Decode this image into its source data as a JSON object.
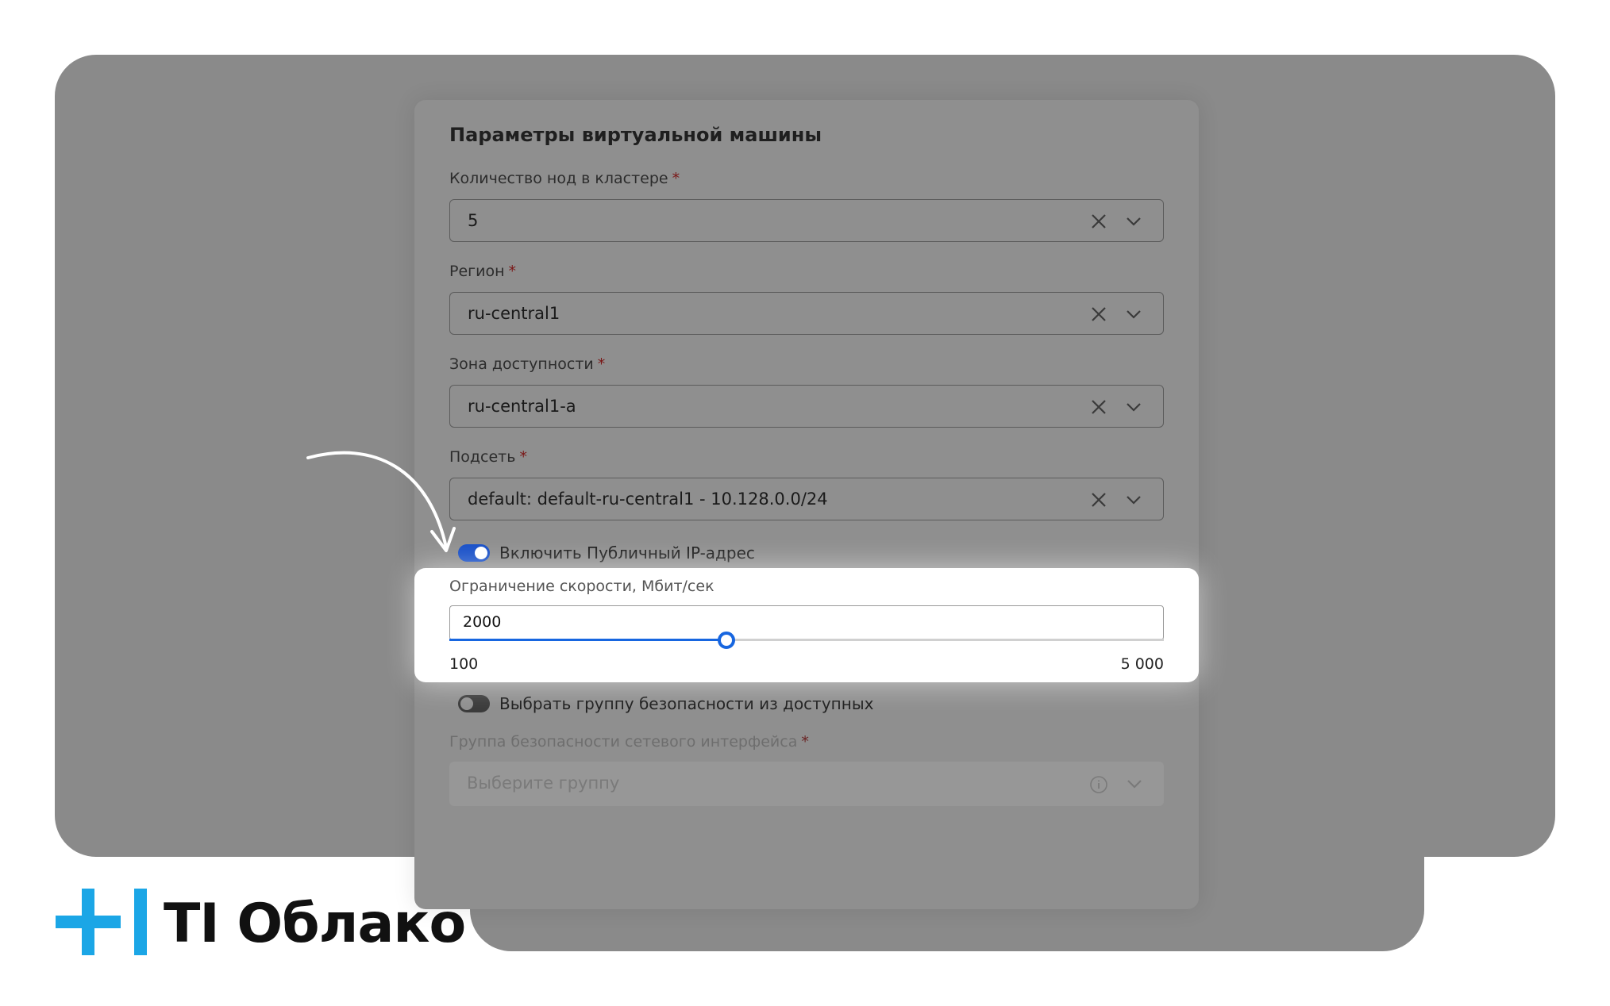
{
  "panel": {
    "title": "Параметры виртуальной машины",
    "fields": [
      {
        "label": "Количество нод в кластере",
        "required": "*",
        "value": "5"
      },
      {
        "label": "Регион",
        "required": "*",
        "value": "ru-central1"
      },
      {
        "label": "Зона доступности",
        "required": "*",
        "value": "ru-central1-a"
      },
      {
        "label": "Подсеть",
        "required": "*",
        "value": "default: default-ru-central1 - 10.128.0.0/24"
      }
    ],
    "public_ip_toggle": {
      "label": "Включить Публичный IP-адрес",
      "on": true
    },
    "speed_limit": {
      "label": "Ограничение скорости, Мбит/сек",
      "value": "2000",
      "min_label": "100",
      "max_label": "5 000",
      "min": 100,
      "max": 5000,
      "current": 2000
    },
    "security_group_toggle": {
      "label": "Выбрать группу безопасности из доступных",
      "on": false
    },
    "security_group_field": {
      "label": "Группа безопасности сетевого интерфейса",
      "required": "*",
      "placeholder": "Выберите группу"
    }
  },
  "brand": {
    "name": "TI Облако",
    "accent": "#1ba6e6"
  },
  "colors": {
    "slider_blue": "#1766e0",
    "toggle_on": "#1850c8",
    "backdrop": "#8a8a8a"
  }
}
